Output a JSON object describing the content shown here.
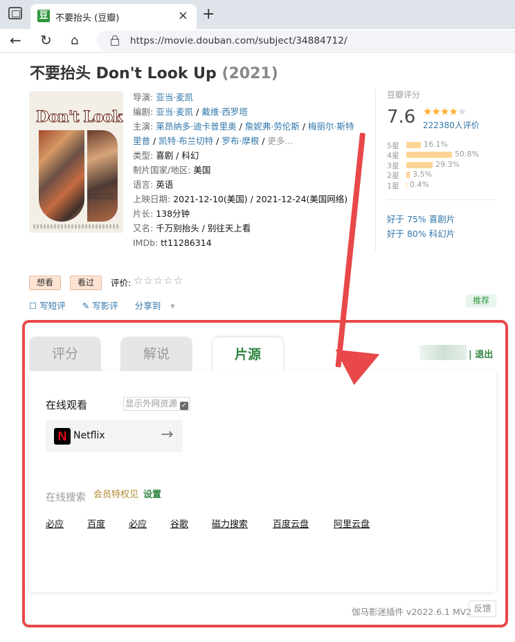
{
  "browser": {
    "tab_title": "不要抬头 (豆瓣)",
    "favicon_glyph": "豆",
    "url": "https://movie.douban.com/subject/34884712/"
  },
  "movie": {
    "title": "不要抬头 Don't Look Up",
    "year": "(2021)",
    "poster": {
      "headline": "Don't Look",
      "tagline": "BASED ON TRULY POSSIBLE EVENTS"
    },
    "director_label": "导演:",
    "director": "亚当·麦凯",
    "writer_label": "编剧:",
    "writers": [
      "亚当·麦凯",
      "戴维·西罗塔"
    ],
    "cast_label": "主演:",
    "cast_line1": [
      "莱昂纳多·迪卡普里奥",
      "詹妮弗·劳伦斯",
      "梅丽尔·斯特"
    ],
    "cast_line2": [
      "里普",
      "凯特·布兰切特",
      "罗布·摩根"
    ],
    "cast_more": "更多...",
    "genre_label": "类型:",
    "genre": "喜剧 / 科幻",
    "country_label": "制片国家/地区:",
    "country": "美国",
    "language_label": "语言:",
    "language": "英语",
    "release_label": "上映日期:",
    "release": "2021-12-10(美国) / 2021-12-24(美国网络)",
    "runtime_label": "片长:",
    "runtime": "138分钟",
    "aka_label": "又名:",
    "aka": "千万别抬头 / 别往天上看",
    "imdb_label": "IMDb:",
    "imdb": "tt11286314"
  },
  "rating": {
    "label": "豆瓣评分",
    "score": "7.6",
    "stars": 4,
    "people": "222380人评价",
    "distribution": [
      {
        "label": "5星",
        "pct": "16.1%",
        "value": 16.1
      },
      {
        "label": "4星",
        "pct": "50.8%",
        "value": 50.8
      },
      {
        "label": "3星",
        "pct": "29.3%",
        "value": 29.3
      },
      {
        "label": "2星",
        "pct": "3.5%",
        "value": 3.5
      },
      {
        "label": "1星",
        "pct": "0.4%",
        "value": 0.4
      }
    ],
    "better_than": [
      "好于 75% 喜剧片",
      "好于 80% 科幻片"
    ]
  },
  "actions": {
    "want": "想看",
    "seen": "看过",
    "rate_label": "评价:",
    "rate_stars": "☆☆☆☆☆",
    "short_review": "写短评",
    "review": "写影评",
    "share": "分享到",
    "recommend": "推荐"
  },
  "plugin": {
    "tabs": [
      "评分",
      "解说",
      "片源"
    ],
    "active_tab": "片源",
    "logout": "| 退出",
    "watch_online": "在线观看",
    "show_external": "显示外网资源",
    "platforms": [
      {
        "name": "Netflix",
        "logo": "N"
      }
    ],
    "search_online": "在线搜索",
    "vip": "会员特权见",
    "settings": "设置",
    "search_links": [
      "必应",
      "百度",
      "必应",
      "谷歌",
      "磁力搜索",
      "百度云盘",
      "阿里云盘"
    ],
    "version": "伽马影迷插件 v2022.6.1 MV2",
    "feedback": "反馈"
  },
  "colors": {
    "annotation": "#e8484a",
    "douban_green": "#2e963d",
    "link_blue": "#3377aa",
    "star": "#ffac2d"
  }
}
